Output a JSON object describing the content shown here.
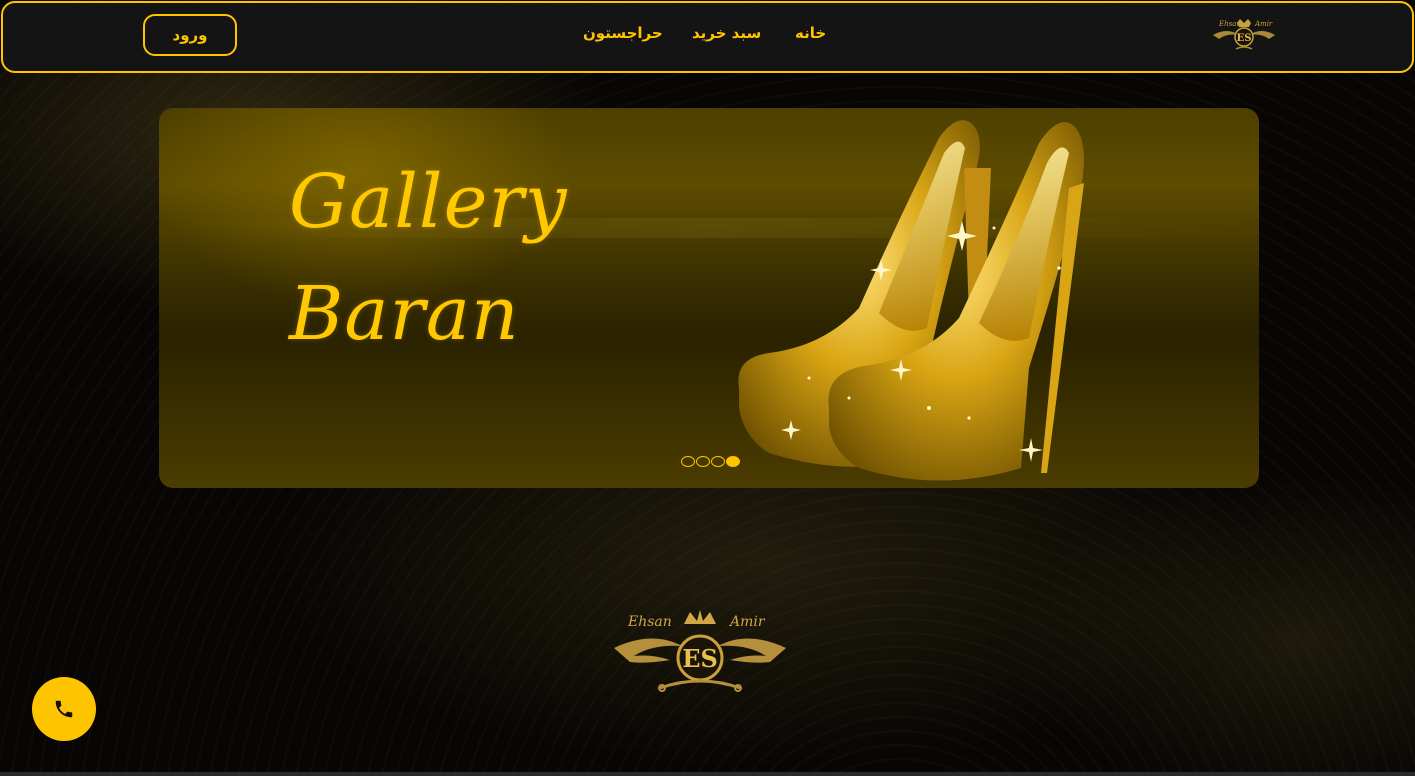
{
  "header": {
    "login_label": "ورود",
    "nav": [
      {
        "label": "خانه"
      },
      {
        "label": "سبد خرید"
      },
      {
        "label": "حراجستون"
      }
    ],
    "logo": {
      "line1": "Ehsan",
      "line2": "Amir",
      "monogram": "ES"
    }
  },
  "banner": {
    "title_line1": "Gallery",
    "title_line2": "Baran",
    "image": "gold-glitter-high-heels",
    "slides_total": 4,
    "active_slide": 4
  },
  "footer": {
    "logo": {
      "line1": "Ehsan",
      "line2": "Amir",
      "monogram": "ES"
    }
  },
  "fab": {
    "icon": "phone-icon"
  },
  "colors": {
    "accent": "#ffc400",
    "header_bg": "#141414",
    "page_bg": "#070604"
  }
}
